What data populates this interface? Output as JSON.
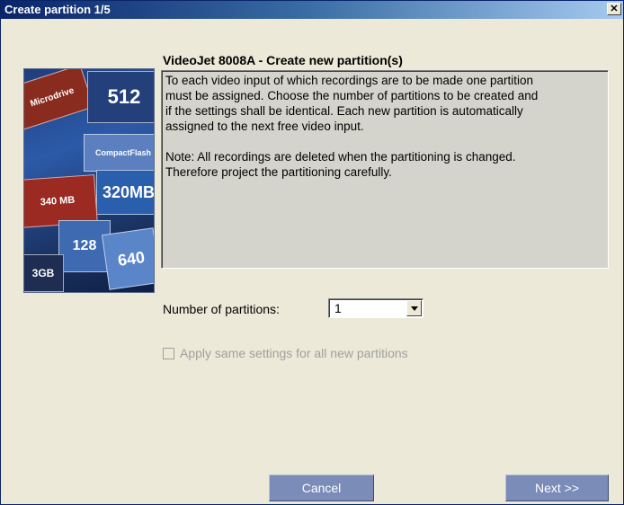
{
  "window": {
    "title": "Create partition 1/5",
    "close_glyph": "✕"
  },
  "splash": {
    "icon": "memory-cards-image",
    "cards": [
      "Microdrive",
      "512",
      "CompactFlash",
      "320MB",
      "340 MB",
      "128",
      "640",
      "3GB"
    ]
  },
  "dialog": {
    "heading": "VideoJet 8008A - Create new partition(s)",
    "description_para1": "To each video input of which recordings are to be made one partition\nmust be assigned. Choose the number of partitions to be created and\nif the settings shall be identical. Each new partition is automatically\nassigned to the next free video input.",
    "description_para2": "Note: All recordings are deleted when the partitioning is changed.\nTherefore project the partitioning carefully.",
    "partitions_label": "Number of partitions:",
    "partitions_value": "1",
    "apply_same_label": "Apply same settings for all new partitions",
    "apply_same_checked": false,
    "apply_same_enabled": false
  },
  "buttons": {
    "cancel": "Cancel",
    "next": "Next >>"
  },
  "colors": {
    "title_bar": "#0a246a",
    "button_bg": "#7b8cb8",
    "text_area_bg": "#d4d4cc"
  }
}
